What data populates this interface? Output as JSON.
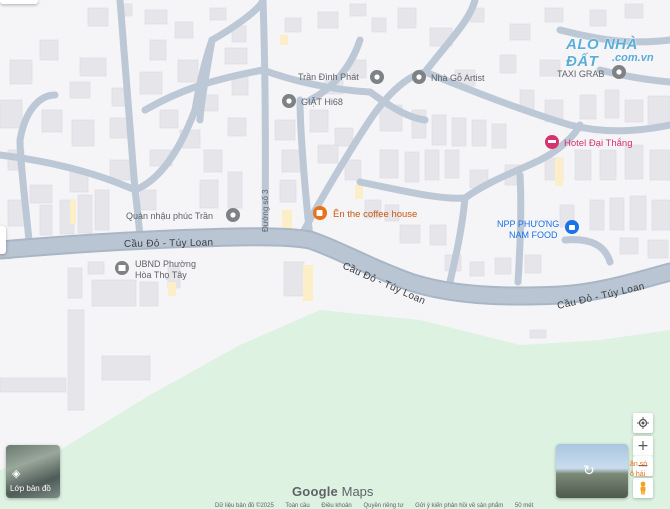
{
  "roads": {
    "main_west": "Cầu Đỏ - Túy Loan",
    "main_mid": "Cầu Đỏ - Túy Loan",
    "main_east": "Cầu Đỏ - Túy Loan",
    "side_street": "Đường số 3"
  },
  "pois": [
    {
      "id": "tran-dinh-phat",
      "name": "Trần Đình Phát",
      "color": "#5f6368"
    },
    {
      "id": "nha-go-artist",
      "name": "Nhà Gỗ Artist",
      "color": "#5f6368"
    },
    {
      "id": "giat-hi68",
      "name": "GIẶT Hi68",
      "color": "#5f6368"
    },
    {
      "id": "taxi-grab",
      "name": "TAXI GRAB",
      "color": "#5f6368"
    },
    {
      "id": "hotel-dai-thang",
      "name": "Hotel Đại Thắng",
      "color": "#d6336c"
    },
    {
      "id": "en-coffee",
      "name": "Ên the coffee house",
      "color": "#e8711a"
    },
    {
      "id": "quan-nhau",
      "name": "Quán nhậu phúc Trần",
      "color": "#5f6368"
    },
    {
      "id": "npp-phuong-nam-1",
      "name": "NPP PHƯƠNG",
      "color": "#1a73e8"
    },
    {
      "id": "npp-phuong-nam-2",
      "name": "NAM FOOD",
      "color": "#1a73e8"
    },
    {
      "id": "ubnd-1",
      "name": "UBND Phường",
      "color": "#5f6368"
    },
    {
      "id": "ubnd-2",
      "name": "Hòa Thọ Tây",
      "color": "#5f6368"
    }
  ],
  "watermark": {
    "line1": "ALO NHÀ ĐẤT",
    "line2": ".com.vn"
  },
  "controls": {
    "zoom_in": "+",
    "zoom_out": "−",
    "layer_label": "Lớp bản đồ",
    "locate_icon": "my-location-icon",
    "pegman_icon": "pegman-icon",
    "rotate_icon": "rotate-360-icon",
    "layers_icon": "layers-icon"
  },
  "logo": {
    "google": "Google",
    "maps": "Maps"
  },
  "footer": {
    "copyright": "Dữ liệu bản đồ ©2025",
    "global": "Toàn cầu",
    "terms": "Điều khoản",
    "privacy": "Quyền riêng tư",
    "feedback": "Gửi ý kiến phản hồi về sản phẩm",
    "scale": "50 mét"
  },
  "right_snippet": {
    "line1": "ăn só",
    "line2": "ô hải"
  },
  "colors": {
    "land": "#f5f4f7",
    "park": "#ddf2e1",
    "road": "#aab8c8",
    "building": "#e8e8ec"
  }
}
